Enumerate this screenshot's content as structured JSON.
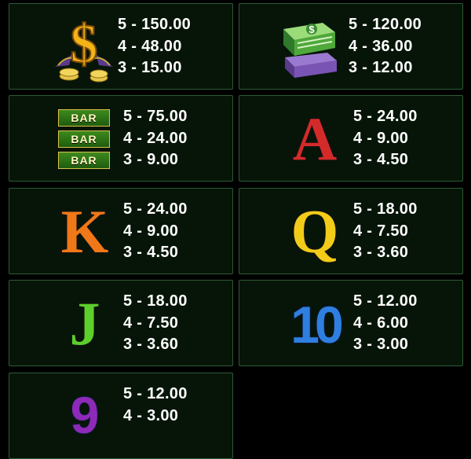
{
  "paytable": [
    {
      "symbol": "dollar-sign",
      "pays": [
        "5 - 150.00",
        "4 - 48.00",
        "3 - 15.00"
      ]
    },
    {
      "symbol": "money-stack",
      "pays": [
        "5 - 120.00",
        "4 - 36.00",
        "3 - 12.00"
      ]
    },
    {
      "symbol": "bar",
      "bar_labels": [
        "BAR",
        "BAR",
        "BAR"
      ],
      "pays": [
        "5 - 75.00",
        "4 - 24.00",
        "3 - 9.00"
      ]
    },
    {
      "symbol": "A",
      "glyph": "A",
      "color": "#d42a2a",
      "pays": [
        "5 - 24.00",
        "4 - 9.00",
        "3 - 4.50"
      ]
    },
    {
      "symbol": "K",
      "glyph": "K",
      "color": "#f07818",
      "pays": [
        "5 - 24.00",
        "4 - 9.00",
        "3 - 4.50"
      ]
    },
    {
      "symbol": "Q",
      "glyph": "Q",
      "color": "#f2cc18",
      "pays": [
        "5 - 18.00",
        "4 - 7.50",
        "3 - 3.60"
      ]
    },
    {
      "symbol": "J",
      "glyph": "J",
      "color": "#5ccf2a",
      "pays": [
        "5 - 18.00",
        "4 - 7.50",
        "3 - 3.60"
      ]
    },
    {
      "symbol": "10",
      "glyph": "10",
      "color": "#2f7fe0",
      "pays": [
        "5 - 12.00",
        "4 - 6.00",
        "3 - 3.00"
      ]
    },
    {
      "symbol": "9",
      "glyph": "9",
      "color": "#8d2ab8",
      "pays": [
        "5 - 12.00",
        "4 - 3.00"
      ]
    }
  ]
}
